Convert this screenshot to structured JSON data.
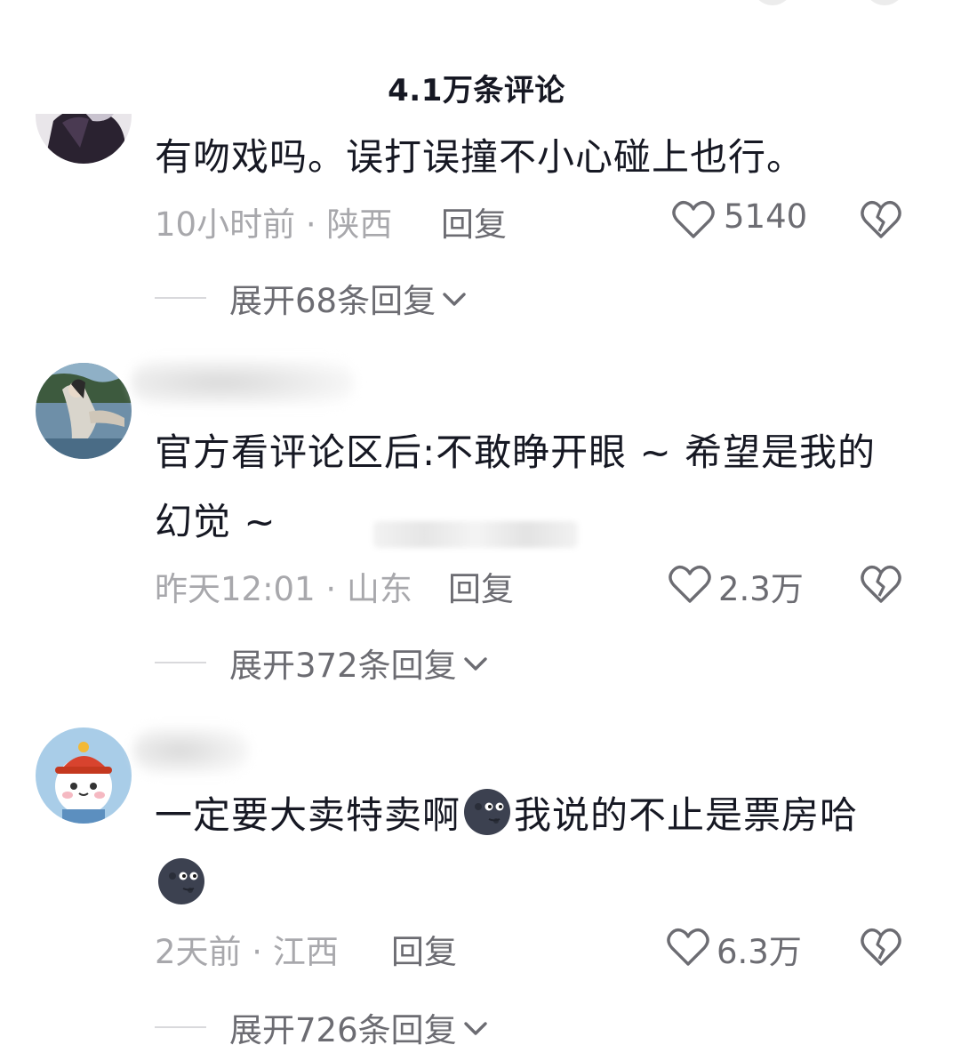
{
  "header": {
    "title": "4.1万条评论"
  },
  "comments": [
    {
      "text": "有吻戏吗。误打误撞不小心碰上也行。",
      "time_location": "10小时前 · 陕西",
      "reply_label": "回复",
      "likes": "5140",
      "expand_label": "展开68条回复"
    },
    {
      "text_line1": "官方看评论区后:不敢睁开眼 ~ 希望是我的",
      "text_line2": "幻觉 ~",
      "time_location": "昨天12:01 · 山东",
      "reply_label": "回复",
      "likes": "2.3万",
      "expand_label": "展开372条回复"
    },
    {
      "text_part1": "一定要大卖特卖啊",
      "text_part2": "我说的不止是票房哈",
      "emoji": "dark-moon-face-emoji",
      "time_location": "2天前 · 江西",
      "reply_label": "回复",
      "likes": "6.3万",
      "expand_label": "展开726条回复"
    }
  ],
  "icons": {
    "like": "heart-outline-icon",
    "dislike": "broken-heart-icon",
    "expand": "chevron-down-icon"
  },
  "colors": {
    "text_primary": "#161823",
    "text_secondary": "#a8a8ac",
    "text_action": "#6c6c72"
  }
}
